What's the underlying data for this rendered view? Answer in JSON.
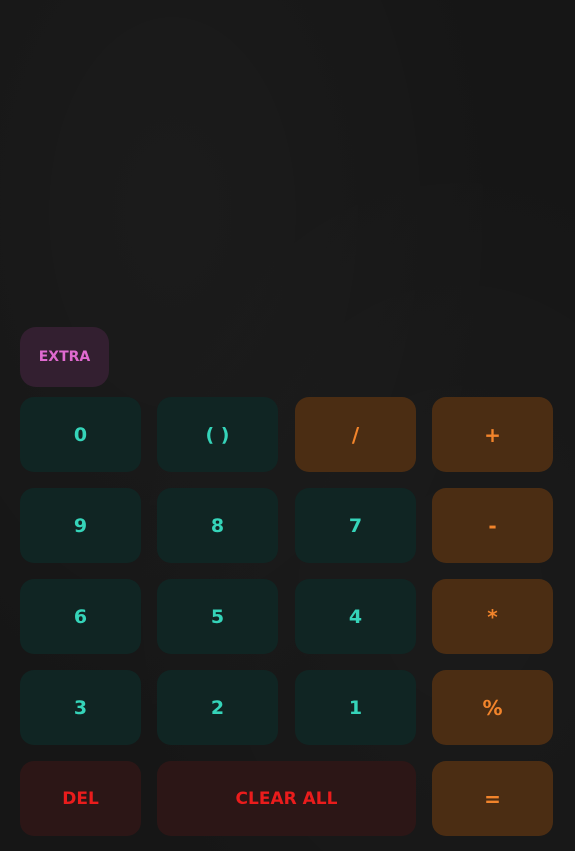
{
  "buttons": {
    "extra": "EXTRA",
    "zero": "0",
    "parens": "( )",
    "divide": "/",
    "plus": "+",
    "nine": "9",
    "eight": "8",
    "seven": "7",
    "minus": "-",
    "six": "6",
    "five": "5",
    "four": "4",
    "multiply": "*",
    "three": "3",
    "two": "2",
    "one": "1",
    "percent": "%",
    "delete": "DEL",
    "clear_all": "CLEAR ALL",
    "equals": "="
  },
  "colors": {
    "background": "#161616",
    "number_key_bg": "#102523",
    "number_key_text": "#35d4b9",
    "operator_key_bg": "#4b2d13",
    "operator_key_text": "#f2842b",
    "delete_key_bg": "#2c1616",
    "delete_key_text": "#ea1c1c",
    "extra_key_bg": "#331f30",
    "extra_key_text": "#e06ad0"
  }
}
